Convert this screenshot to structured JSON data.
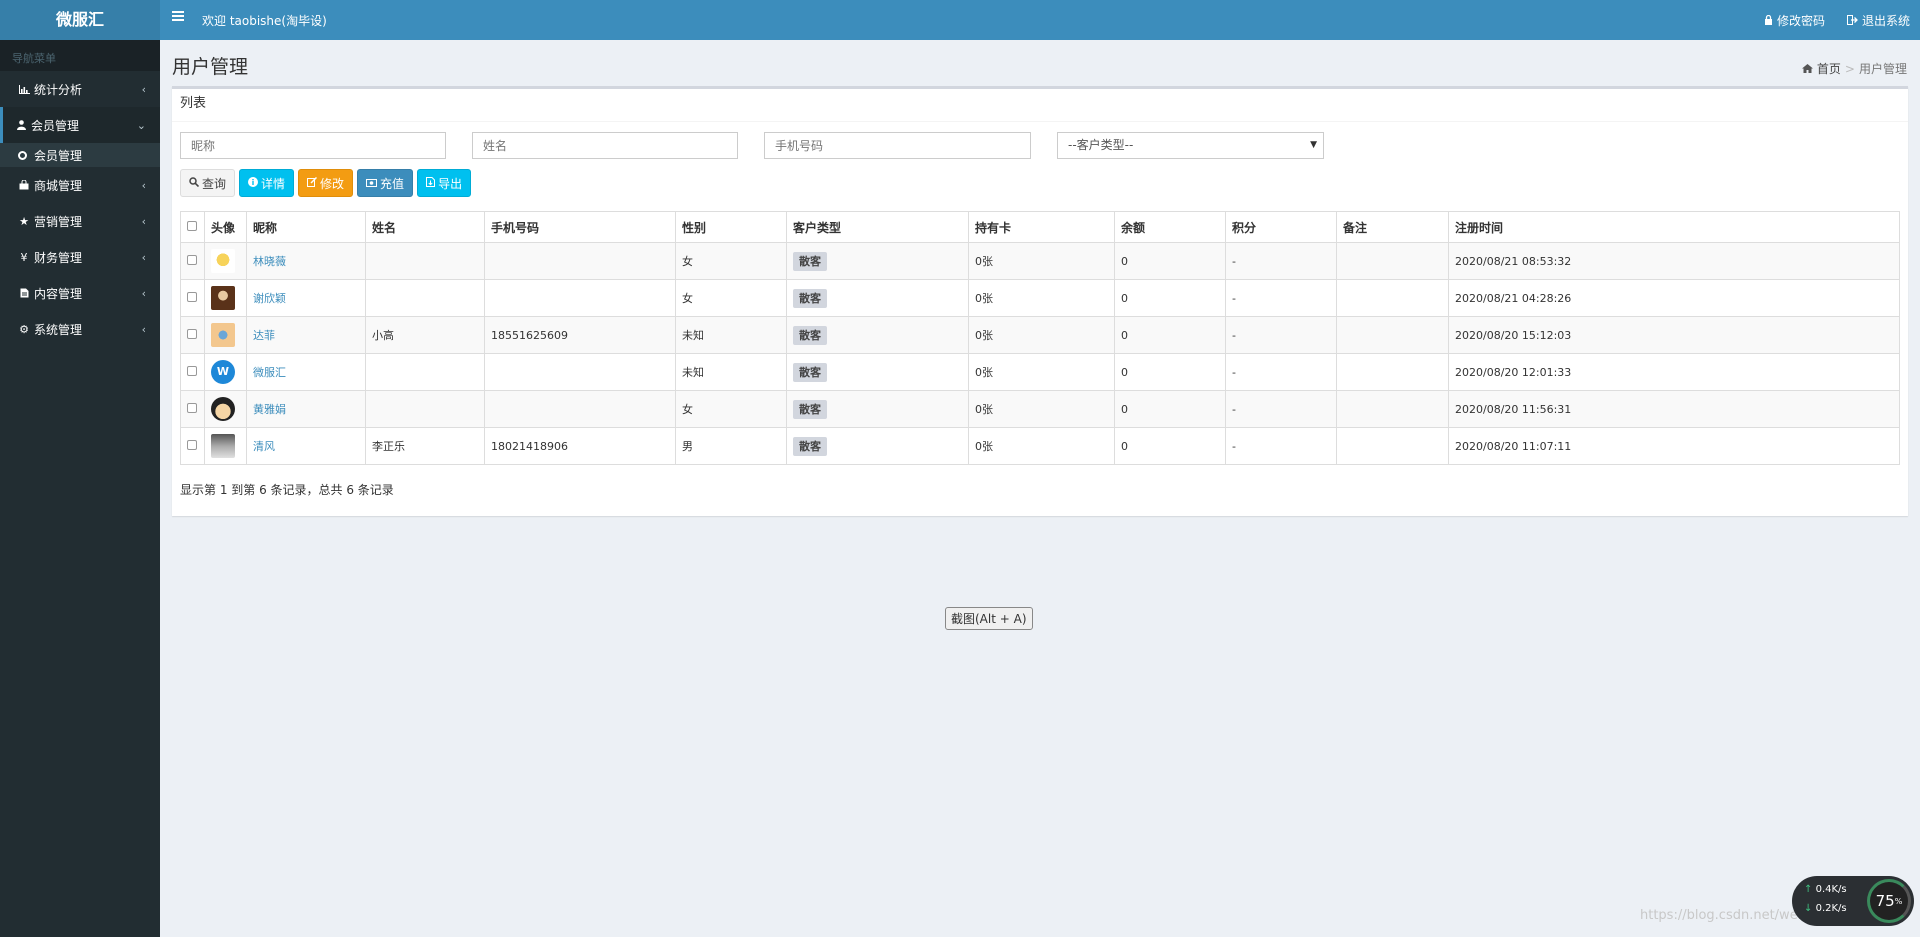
{
  "header": {
    "logo": "微服汇",
    "welcome": "欢迎 taobishe(淘毕设)",
    "change_password": "修改密码",
    "logout": "退出系统"
  },
  "sidebar": {
    "nav_header": "导航菜单",
    "items": [
      {
        "label": "统计分析",
        "icon": "bar-chart-icon"
      },
      {
        "label": "会员管理",
        "icon": "user-icon"
      },
      {
        "label": "商城管理",
        "icon": "shopping-bag-icon"
      },
      {
        "label": "营销管理",
        "icon": "star-icon"
      },
      {
        "label": "财务管理",
        "icon": "yen-icon"
      },
      {
        "label": "内容管理",
        "icon": "document-icon"
      },
      {
        "label": "系统管理",
        "icon": "gear-icon"
      }
    ],
    "sub_active": "会员管理"
  },
  "page": {
    "title": "用户管理",
    "breadcrumb_home": "首页",
    "breadcrumb_current": "用户管理"
  },
  "box": {
    "title": "列表",
    "filters": {
      "nickname_placeholder": "昵称",
      "name_placeholder": "姓名",
      "phone_placeholder": "手机号码",
      "customer_type_selected": "--客户类型--"
    },
    "buttons": {
      "query": "查询",
      "details": "详情",
      "edit": "修改",
      "recharge": "充值",
      "export": "导出"
    },
    "columns": [
      "头像",
      "昵称",
      "姓名",
      "手机号码",
      "性别",
      "客户类型",
      "持有卡",
      "余额",
      "积分",
      "备注",
      "注册时间"
    ],
    "rows": [
      {
        "nickname": "林晓薇",
        "name": "",
        "phone": "",
        "gender": "女",
        "type": "散客",
        "cards": "0张",
        "balance": "0",
        "points": "-",
        "note": "",
        "registered": "2020/08/21 08:53:32"
      },
      {
        "nickname": "谢欣颖",
        "name": "",
        "phone": "",
        "gender": "女",
        "type": "散客",
        "cards": "0张",
        "balance": "0",
        "points": "-",
        "note": "",
        "registered": "2020/08/21 04:28:26"
      },
      {
        "nickname": "达菲",
        "name": "小高",
        "phone": "18551625609",
        "gender": "未知",
        "type": "散客",
        "cards": "0张",
        "balance": "0",
        "points": "-",
        "note": "",
        "registered": "2020/08/20 15:12:03"
      },
      {
        "nickname": "微服汇",
        "name": "",
        "phone": "",
        "gender": "未知",
        "type": "散客",
        "cards": "0张",
        "balance": "0",
        "points": "-",
        "note": "",
        "registered": "2020/08/20 12:01:33"
      },
      {
        "nickname": "黄雅娟",
        "name": "",
        "phone": "",
        "gender": "女",
        "type": "散客",
        "cards": "0张",
        "balance": "0",
        "points": "-",
        "note": "",
        "registered": "2020/08/20 11:56:31"
      },
      {
        "nickname": "清风",
        "name": "李正乐",
        "phone": "18021418906",
        "gender": "男",
        "type": "散客",
        "cards": "0张",
        "balance": "0",
        "points": "-",
        "note": "",
        "registered": "2020/08/20 11:07:11"
      }
    ],
    "summary": "显示第 1 到第 6 条记录，总共 6 条记录"
  },
  "overlay": {
    "capture_button": "截图(Alt + A)",
    "watermark": "https://blog.csdn.net/weixin_47190619",
    "upload_speed": "0.4K/s",
    "download_speed": "0.2K/s",
    "gauge_value": "75",
    "gauge_unit": "%"
  },
  "colors": {
    "header": "#3c8dbc",
    "sidebar": "#222d32",
    "info": "#00c0ef",
    "warning": "#f39c12",
    "primary": "#3c8dbc"
  }
}
